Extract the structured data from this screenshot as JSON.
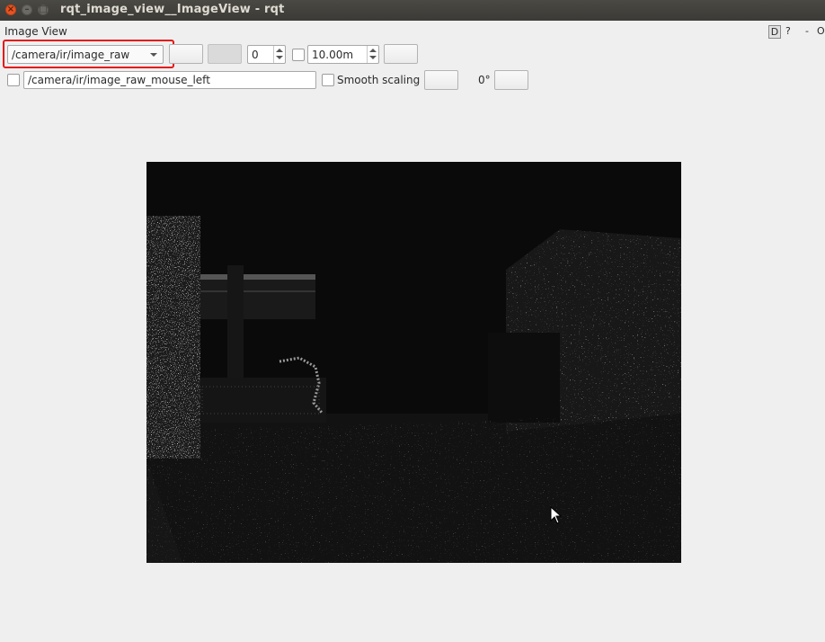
{
  "window": {
    "title": "rqt_image_view__ImageView - rqt",
    "close_glyph": "×",
    "min_glyph": "–",
    "max_glyph": "□"
  },
  "plugin": {
    "title": "Image View",
    "dock_d": "D",
    "dock_help": "?",
    "dock_minimize": "-",
    "dock_close": "O"
  },
  "toolbar": {
    "topic_selected": "/camera/ir/image_raw",
    "spin_value": "0",
    "max_range": "10.00m"
  },
  "mouse": {
    "topic": "/camera/ir/image_raw_mouse_left"
  },
  "options": {
    "smooth_scaling_label": "Smooth scaling",
    "rotation": "0°"
  },
  "colors": {
    "highlight": "#e5191b",
    "titlebar": "#3b3a36",
    "close_button": "#e95420",
    "image_background": "#0b0b0b"
  },
  "icons": {
    "window_close": "close-icon",
    "window_minimize": "minimize-icon",
    "window_maximize": "maximize-icon",
    "combo_arrow": "chevron-down-icon",
    "cursor": "arrow-cursor-icon"
  }
}
